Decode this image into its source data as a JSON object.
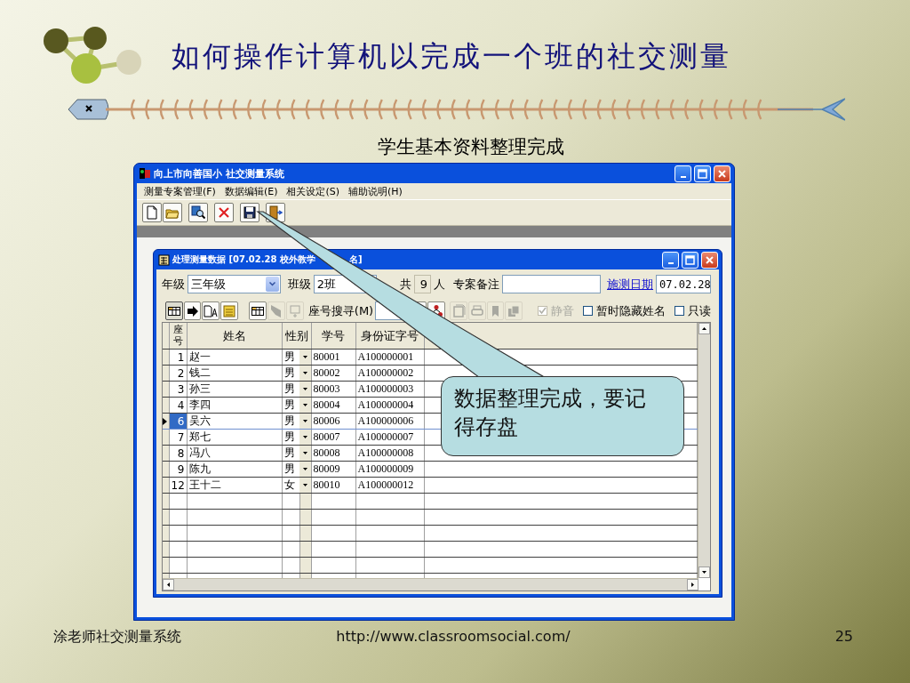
{
  "slide": {
    "title": "如何操作计算机以完成一个班的社交测量",
    "subtitle": "学生基本资料整理完成",
    "footer_left": "涂老师社交测量系统",
    "footer_url": "http://www.classroomsocial.com/",
    "page_number": "25"
  },
  "app_window": {
    "title": "向上市向善国小 社交测量系统",
    "menu": [
      "测量专案管理(F)",
      "数据编辑(E)",
      "相关设定(S)",
      "辅助说明(H)"
    ]
  },
  "child_window": {
    "title": "处理测量数据 [07.02.28  校外教学",
    "title_tail": "名]",
    "form": {
      "grade_label": "年级",
      "grade_value": "三年级",
      "class_label": "班级",
      "class_value": "2班",
      "count_prefix": "共",
      "count": "9",
      "count_suffix": "人",
      "note_label": "专案备注",
      "date_link": "施测日期",
      "date_value": "07.02.28"
    },
    "search_label": "座号搜寻(M)",
    "checkboxes": [
      {
        "label": "静音",
        "checked": true,
        "disabled": true
      },
      {
        "label": "暂时隐藏姓名",
        "checked": false,
        "disabled": false
      },
      {
        "label": "只读",
        "checked": false,
        "disabled": false
      }
    ],
    "grid": {
      "columns": [
        "座号",
        "姓名",
        "性别",
        "学号",
        "身份证字号"
      ],
      "rows": [
        {
          "seat": "1",
          "name": "赵一",
          "gender": "男",
          "student_id": "80001",
          "id_number": "A100000001",
          "selected": false
        },
        {
          "seat": "2",
          "name": "钱二",
          "gender": "男",
          "student_id": "80002",
          "id_number": "A100000002",
          "selected": false
        },
        {
          "seat": "3",
          "name": "孙三",
          "gender": "男",
          "student_id": "80003",
          "id_number": "A100000003",
          "selected": false
        },
        {
          "seat": "4",
          "name": "李四",
          "gender": "男",
          "student_id": "80004",
          "id_number": "A100000004",
          "selected": false
        },
        {
          "seat": "6",
          "name": "吴六",
          "gender": "男",
          "student_id": "80006",
          "id_number": "A100000006",
          "selected": true
        },
        {
          "seat": "7",
          "name": "郑七",
          "gender": "男",
          "student_id": "80007",
          "id_number": "A100000007",
          "selected": false
        },
        {
          "seat": "8",
          "name": "冯八",
          "gender": "男",
          "student_id": "80008",
          "id_number": "A100000008",
          "selected": false
        },
        {
          "seat": "9",
          "name": "陈九",
          "gender": "男",
          "student_id": "80009",
          "id_number": "A100000009",
          "selected": false
        },
        {
          "seat": "12",
          "name": "王十二",
          "gender": "女",
          "student_id": "80010",
          "id_number": "A100000012",
          "selected": false
        }
      ]
    }
  },
  "callout": {
    "text": "数据整理完成，要记得存盘"
  }
}
